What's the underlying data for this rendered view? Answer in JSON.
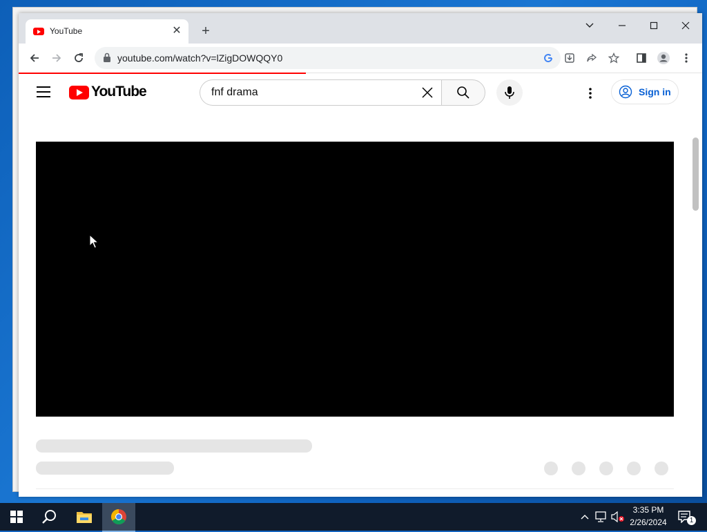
{
  "browser": {
    "tab_title": "YouTube",
    "url": "youtube.com/watch?v=lZigDOWQQY0",
    "load_progress_percent": 42
  },
  "youtube": {
    "logo_text": "YouTube",
    "search_value": "fnf drama",
    "signin_label": "Sign in"
  },
  "taskbar": {
    "time": "3:35 PM",
    "date": "2/26/2024",
    "notification_count": "1"
  },
  "colors": {
    "brand_red": "#ff0000",
    "link_blue": "#065fd4"
  },
  "icons": [
    "youtube-favicon",
    "close-icon",
    "plus-icon",
    "chevron-down-icon",
    "minimize-icon",
    "maximize-icon",
    "back-arrow-icon",
    "forward-arrow-icon",
    "reload-icon",
    "lock-icon",
    "google-icon",
    "download-icon",
    "share-icon",
    "star-icon",
    "sidebar-icon",
    "profile-icon",
    "kebab-menu-icon",
    "hamburger-menu-icon",
    "search-icon",
    "microphone-icon",
    "account-circle-icon",
    "windows-start-icon",
    "file-explorer-icon",
    "chrome-icon",
    "chevron-up-icon",
    "network-icon",
    "volume-muted-icon",
    "notification-icon"
  ]
}
